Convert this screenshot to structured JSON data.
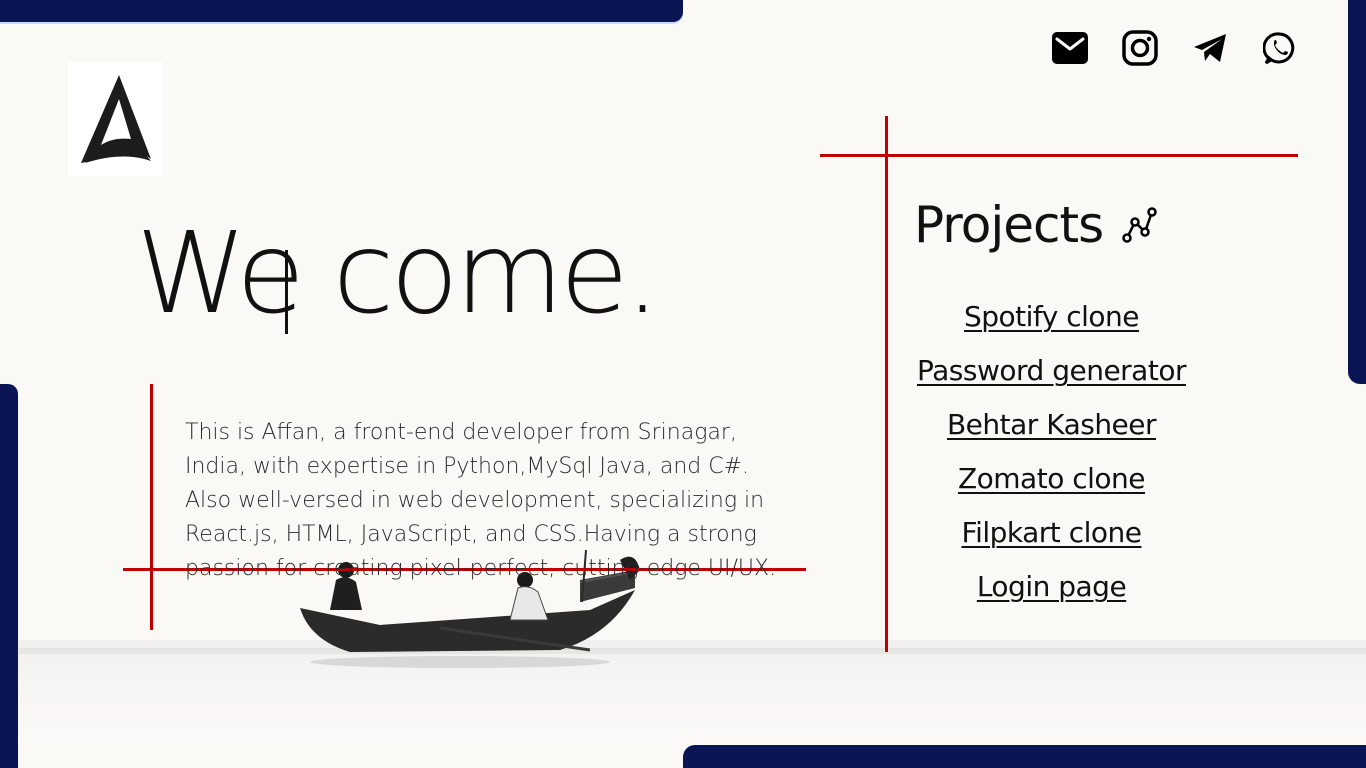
{
  "welcome": {
    "heading": "We come."
  },
  "bio": {
    "text": "This is Affan, a front-end developer from Srinagar, India, with expertise in Python,MySql Java, and C#. Also well-versed in web development, specializing in React.js, HTML, JavaScript, and CSS.Having a strong passion for creating pixel-perfect, cutting-edge UI/UX."
  },
  "social": [
    "email-icon",
    "instagram-icon",
    "telegram-icon",
    "whatsapp-icon"
  ],
  "projects": {
    "title": "Projects",
    "items": [
      {
        "label": "Spotify clone"
      },
      {
        "label": "Password generator"
      },
      {
        "label": "Behtar Kasheer"
      },
      {
        "label": "Zomato clone"
      },
      {
        "label": "Filpkart clone"
      },
      {
        "label": "Login page"
      }
    ]
  },
  "colors": {
    "navy": "#0c1553",
    "accent_red": "#c00000",
    "background": "#fbf9f6",
    "text": "#111111"
  }
}
